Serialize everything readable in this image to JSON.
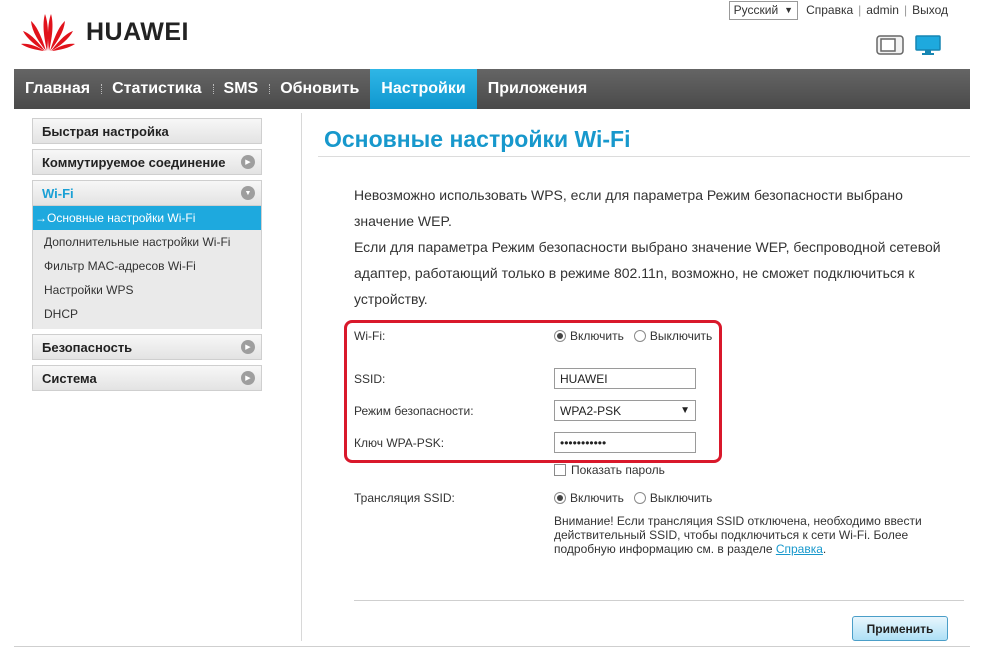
{
  "header": {
    "logo_text": "HUAWEI",
    "language": "Русский",
    "help_label": "Справка",
    "user_label": "admin",
    "logout_label": "Выход"
  },
  "colors": {
    "accent": "#1ea9de",
    "highlight": "#d9182b",
    "logo_red": "#e1121b"
  },
  "nav": {
    "items": [
      "Главная",
      "Статистика",
      "SMS",
      "Обновить",
      "Настройки",
      "Приложения"
    ],
    "active": "Настройки"
  },
  "sidebar": {
    "quick": "Быстрая настройка",
    "dialup": "Коммутируемое соединение",
    "wifi": "Wi-Fi",
    "wifi_items": [
      "Основные настройки Wi-Fi",
      "Дополнительные настройки Wi-Fi",
      "Фильтр MAC-адресов Wi-Fi",
      "Настройки WPS",
      "DHCP"
    ],
    "active_prefix": "→",
    "security": "Безопасность",
    "system": "Система"
  },
  "main": {
    "title": "Основные настройки Wi-Fi",
    "note_line1": "Невозможно использовать WPS, если для параметра Режим безопасности выбрано значение WEP.",
    "note_line2": "Если для параметра Режим безопасности выбрано значение WEP, беспроводной сетевой адаптер, работающий только в режиме 802.11n, возможно, не сможет подключиться к устройству.",
    "wifi_label": "Wi-Fi:",
    "enable": "Включить",
    "disable": "Выключить",
    "ssid_label": "SSID:",
    "ssid_value": "HUAWEI",
    "security_label": "Режим безопасности:",
    "security_value": "WPA2-PSK",
    "key_label": "Ключ WPA-PSK:",
    "key_value": "•••••••••••",
    "show_password": "Показать пароль",
    "broadcast_label": "Трансляция SSID:",
    "warning_text": "Внимание! Если трансляция SSID отключена, необходимо ввести действительный SSID, чтобы подключиться к сети Wi-Fi. Более подробную информацию см. в разделе ",
    "warning_link": "Справка",
    "warning_end": ".",
    "apply_label": "Применить"
  }
}
